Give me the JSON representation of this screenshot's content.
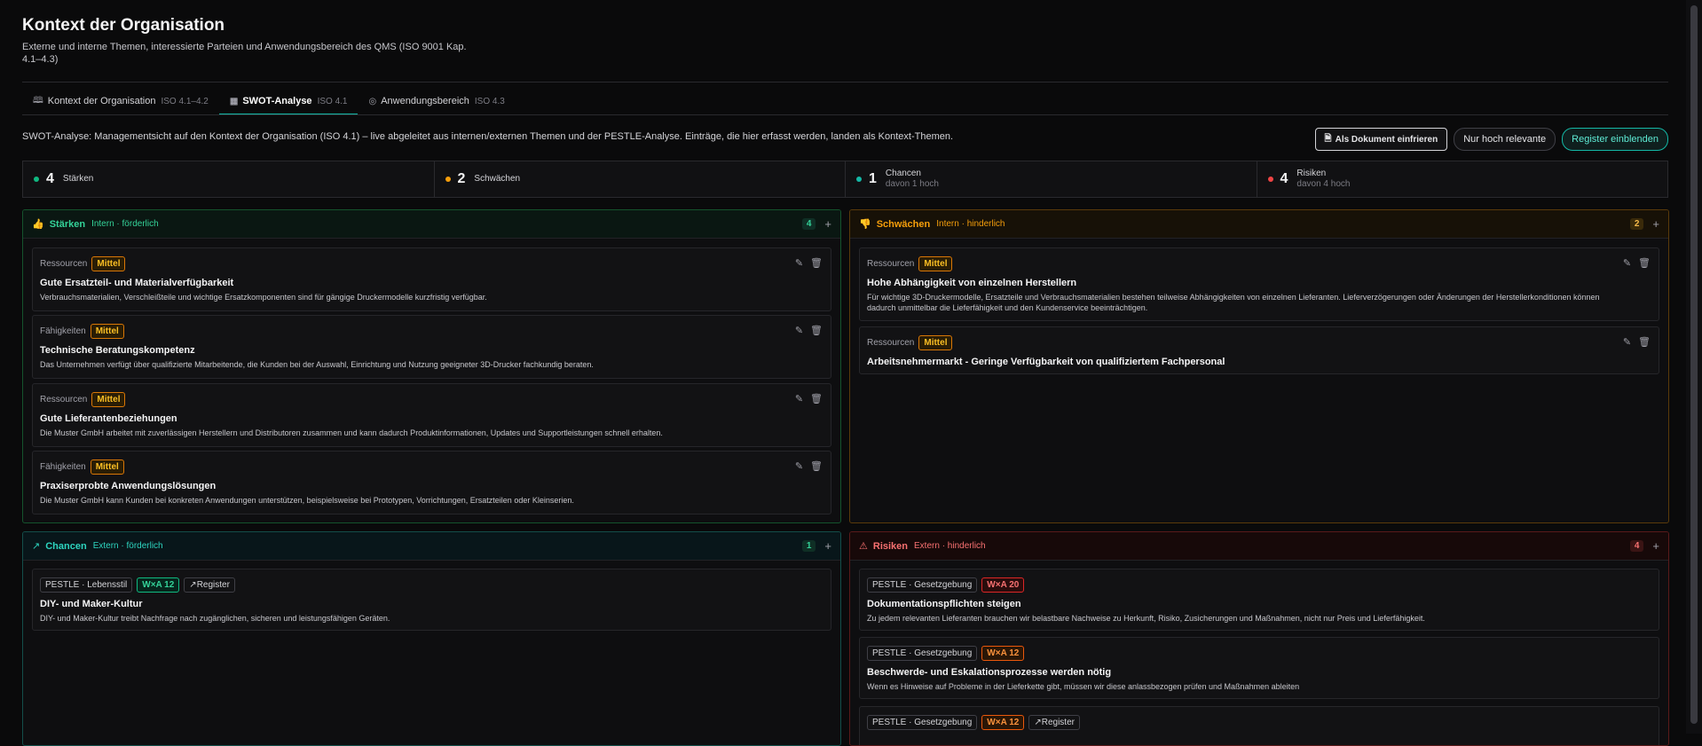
{
  "header": {
    "title": "Kontext der Organisation",
    "subtitle": "Externe und interne Themen, interessierte Parteien und Anwendungsbereich des QMS (ISO 9001 Kap. 4.1–4.3)"
  },
  "tabs": [
    {
      "label": "Kontext der Organisation",
      "iso": "ISO 4.1–4.2",
      "icon": "book-icon"
    },
    {
      "label": "SWOT-Analyse",
      "iso": "ISO 4.1",
      "icon": "grid-icon",
      "active": true
    },
    {
      "label": "Anwendungsbereich",
      "iso": "ISO 4.3",
      "icon": "target-icon"
    }
  ],
  "intro": "SWOT-Analyse: Managementsicht auf den Kontext der Organisation (ISO 4.1) – live abgeleitet aus internen/externen Themen und der PESTLE-Analyse. Einträge, die hier erfasst werden, landen als Kontext-Themen.",
  "actions": {
    "doc": "Als Dokument einfrieren",
    "relevant": "Nur hoch relevante",
    "register": "Register einblenden"
  },
  "stats": [
    {
      "num": "4",
      "label": "Stärken",
      "sub": "",
      "color": "#10b981"
    },
    {
      "num": "2",
      "label": "Schwächen",
      "sub": "",
      "color": "#f59e0b"
    },
    {
      "num": "1",
      "label": "Chancen",
      "sub": "davon 1 hoch",
      "color": "#14b8a6"
    },
    {
      "num": "4",
      "label": "Risiken",
      "sub": "davon 4 hoch",
      "color": "#ef4444"
    }
  ],
  "panels": {
    "staerken": {
      "title": "Stärken",
      "scope": "Intern · förderlich",
      "count": "4",
      "items": [
        {
          "cat": "Ressourcen",
          "level": "Mittel",
          "title": "Gute Ersatzteil- und Materialverfügbarkeit",
          "desc": "Verbrauchsmaterialien, Verschleißteile und wichtige Ersatzkomponenten sind für gängige Druckermodelle kurzfristig verfügbar."
        },
        {
          "cat": "Fähigkeiten",
          "level": "Mittel",
          "title": "Technische Beratungskompetenz",
          "desc": "Das Unternehmen verfügt über qualifizierte Mitarbeitende, die Kunden bei der Auswahl, Einrichtung und Nutzung geeigneter 3D-Drucker fachkundig beraten."
        },
        {
          "cat": "Ressourcen",
          "level": "Mittel",
          "title": "Gute Lieferantenbeziehungen",
          "desc": "Die Muster GmbH arbeitet mit zuverlässigen Herstellern und Distributoren zusammen und kann dadurch Produktinformationen, Updates und Supportleistungen schnell erhalten."
        },
        {
          "cat": "Fähigkeiten",
          "level": "Mittel",
          "title": "Praxiserprobte Anwendungslösungen",
          "desc": "Die Muster GmbH kann Kunden bei konkreten Anwendungen unterstützen, beispielsweise bei Prototypen, Vorrichtungen, Ersatzteilen oder Kleinserien."
        }
      ]
    },
    "schwaechen": {
      "title": "Schwächen",
      "scope": "Intern · hinderlich",
      "count": "2",
      "items": [
        {
          "cat": "Ressourcen",
          "level": "Mittel",
          "title": "Hohe Abhängigkeit von einzelnen Herstellern",
          "desc": "Für wichtige 3D-Druckermodelle, Ersatzteile und Verbrauchsmaterialien bestehen teilweise Abhängigkeiten von einzelnen Lieferanten. Lieferverzögerungen oder Änderungen der Herstellerkonditionen können dadurch unmittelbar die Lieferfähigkeit und den Kundenservice beeinträchtigen."
        },
        {
          "cat": "Ressourcen",
          "level": "Mittel",
          "title": "Arbeitsnehmermarkt - Geringe Verfügbarkeit von qualifiziertem Fachpersonal",
          "desc": ""
        }
      ]
    },
    "chancen": {
      "title": "Chancen",
      "scope": "Extern · förderlich",
      "count": "1",
      "items": [
        {
          "source": "PESTLE · Lebensstil",
          "score": "W×A 12",
          "register": "Register",
          "title": "DIY- und Maker-Kultur",
          "desc": "DIY- und Maker-Kultur treibt Nachfrage nach zugänglichen, sicheren und leistungsfähigen Geräten."
        }
      ]
    },
    "risiken": {
      "title": "Risiken",
      "scope": "Extern · hinderlich",
      "count": "4",
      "items": [
        {
          "source": "PESTLE · Gesetzgebung",
          "score": "W×A 20",
          "register": "",
          "title": "Dokumentationspflichten steigen",
          "desc": "Zu jedem relevanten Lieferanten brauchen wir belastbare Nachweise zu Herkunft, Risiko, Zusicherungen und Maßnahmen, nicht nur Preis und Lieferfähigkeit."
        },
        {
          "source": "PESTLE · Gesetzgebung",
          "score": "W×A 12",
          "register": "",
          "title": "Beschwerde- und Eskalationsprozesse werden nötig",
          "desc": "Wenn es Hinweise auf Probleme in der Lieferkette gibt, müssen wir diese anlassbezogen prüfen und Maßnahmen ableiten"
        },
        {
          "source": "PESTLE · Gesetzgebung",
          "score": "W×A 12",
          "register": "Register",
          "title": "",
          "desc": ""
        }
      ]
    }
  }
}
